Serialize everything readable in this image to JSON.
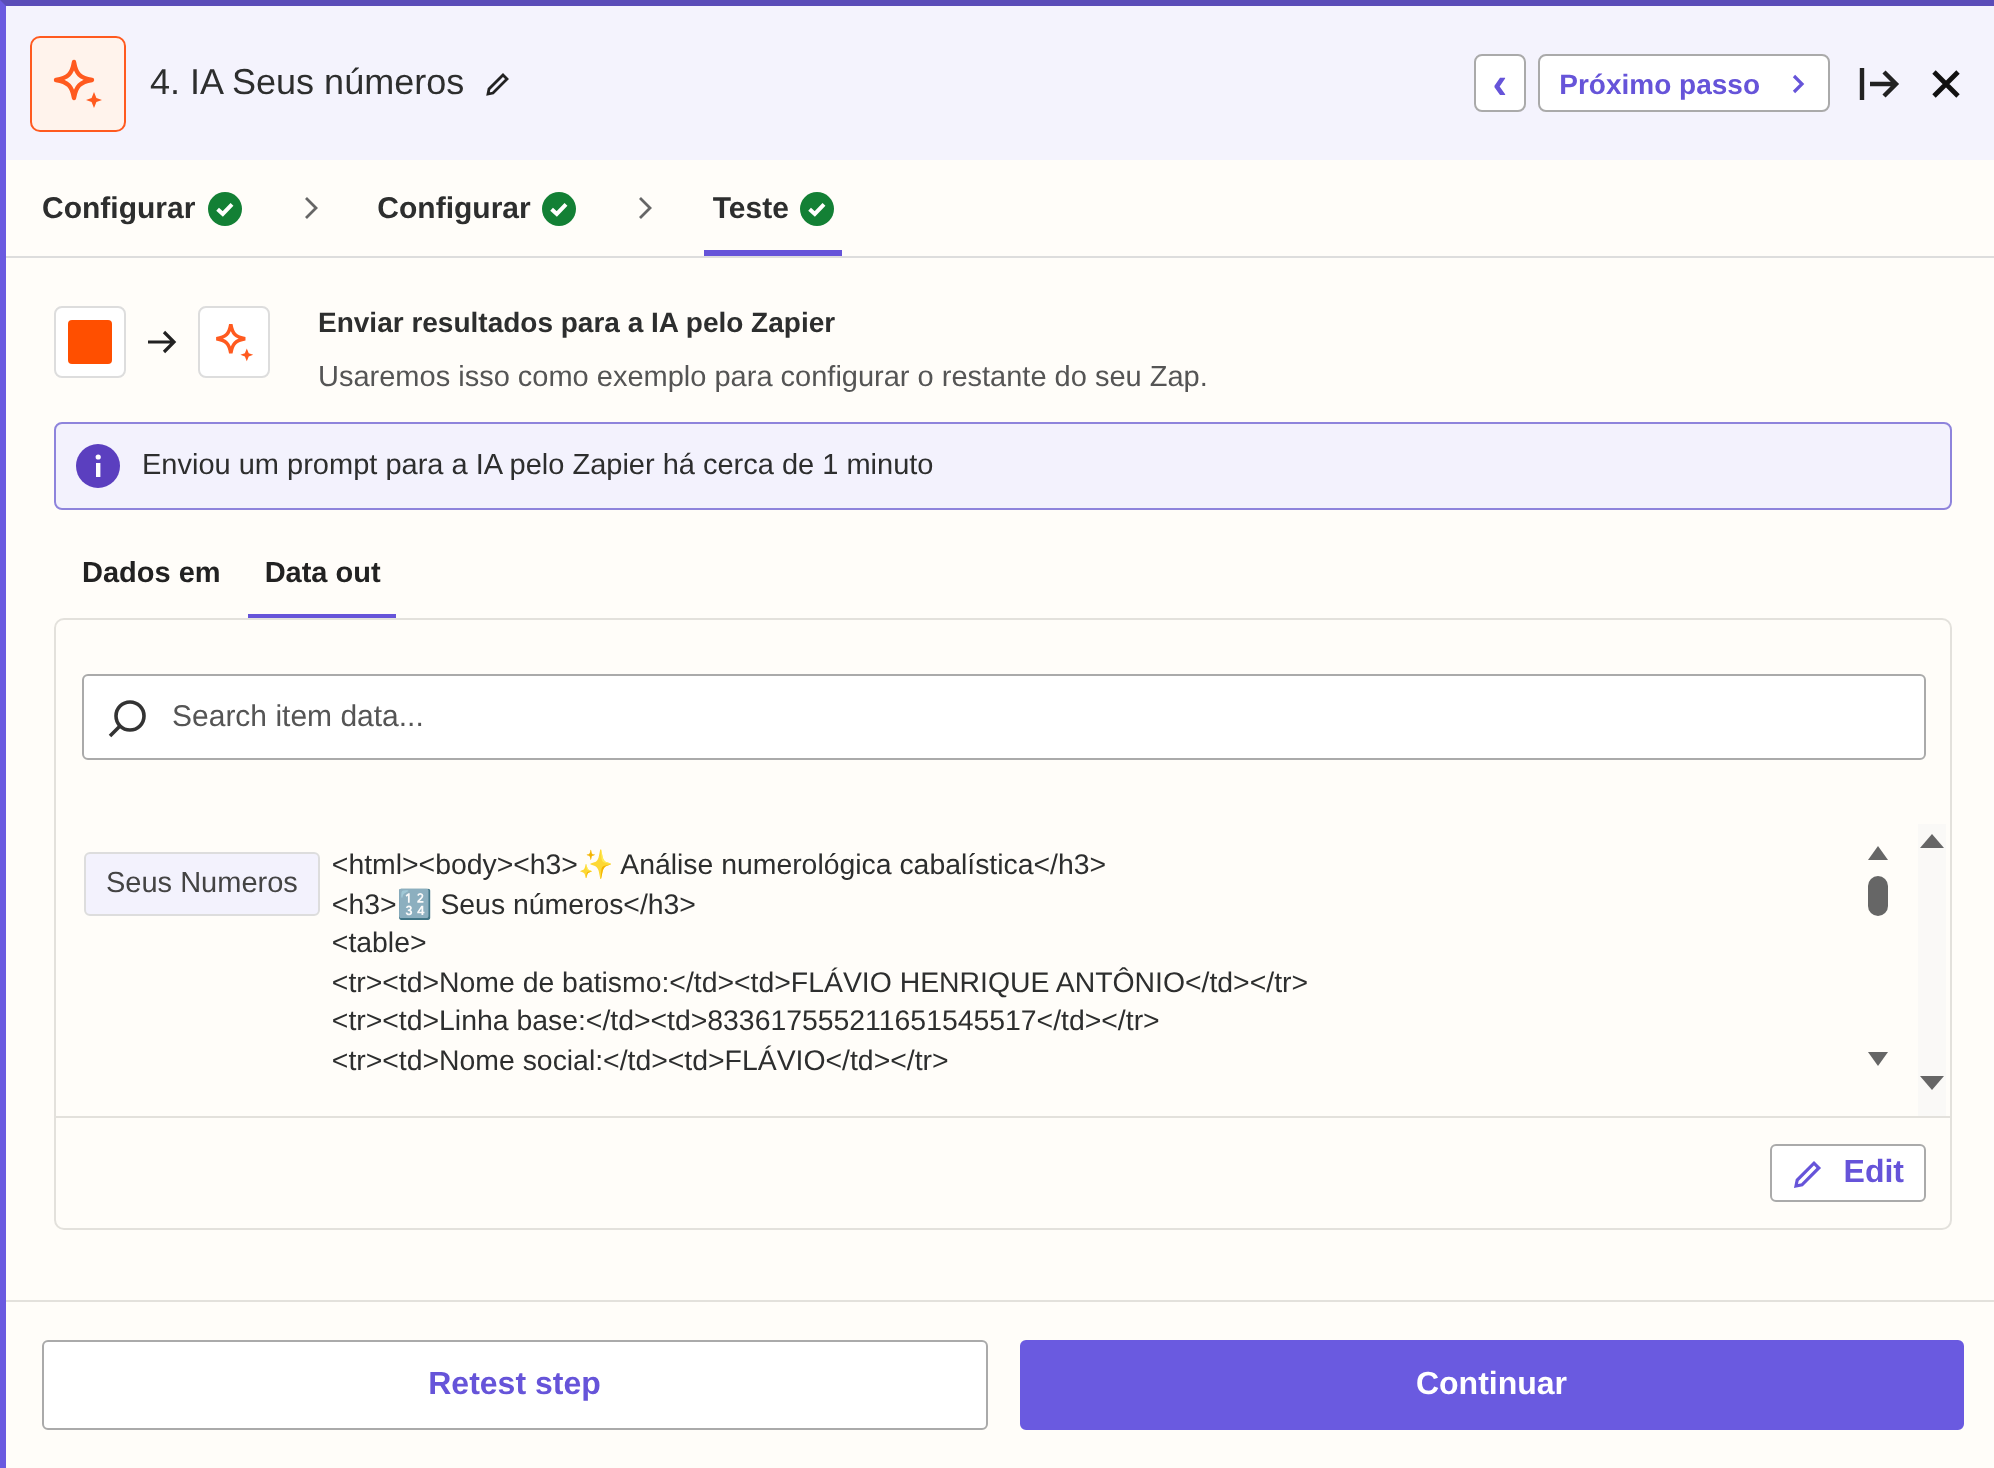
{
  "header": {
    "title": "4. IA Seus números",
    "prev_label": "‹",
    "next_label": "Próximo passo"
  },
  "steps": [
    {
      "label": "Configurar",
      "done": true,
      "selected": false
    },
    {
      "label": "Configurar",
      "done": true,
      "selected": false
    },
    {
      "label": "Teste",
      "done": true,
      "selected": true
    }
  ],
  "trigger": {
    "title": "Enviar resultados para a IA pelo Zapier",
    "subtitle": "Usaremos isso como exemplo para configurar o restante do seu Zap."
  },
  "notice": "Enviou um prompt para a IA pelo Zapier há cerca de 1 minuto",
  "data_tabs": [
    {
      "label": "Dados em",
      "selected": false
    },
    {
      "label": "Data out",
      "selected": true
    }
  ],
  "search": {
    "placeholder": "Search item data..."
  },
  "item": {
    "key": "Seus Numeros",
    "lines": [
      "<html><body><h3>✨ Análise numerológica cabalística</h3>",
      "<h3>🔢 Seus números</h3>",
      "<table>",
      "<tr><td>Nome de batismo:</td><td>FLÁVIO HENRIQUE ANTÔNIO</td></tr>",
      "<tr><td>Linha base:</td><td>833617555211651545517</td></tr>",
      "<tr><td>Nome social:</td><td>FLÁVIO</td></tr>"
    ]
  },
  "edit_label": "Edit",
  "buttons": [
    {
      "label": "Retest step",
      "kind": "secondary"
    },
    {
      "label": "Continuar",
      "kind": "primary"
    }
  ]
}
